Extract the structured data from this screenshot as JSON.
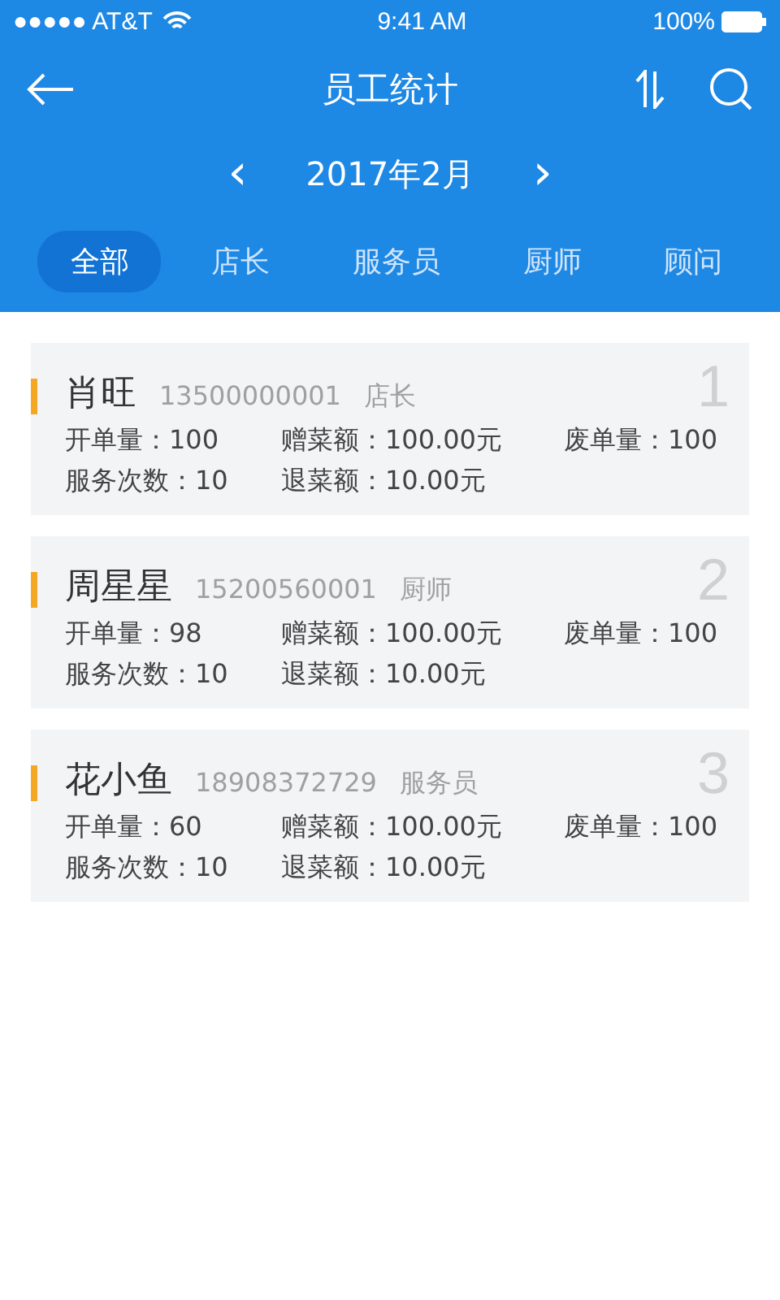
{
  "status_bar": {
    "carrier": "●●●●● AT&T",
    "time": "9:41 AM",
    "battery": "100%"
  },
  "header": {
    "title": "员工统计"
  },
  "month_nav": {
    "prev": "‹",
    "label": "2017年2月",
    "next": "›"
  },
  "tabs": [
    {
      "label": "全部",
      "selected": true
    },
    {
      "label": "店长",
      "selected": false
    },
    {
      "label": "服务员",
      "selected": false
    },
    {
      "label": "厨师",
      "selected": false
    },
    {
      "label": "顾问",
      "selected": false
    }
  ],
  "staff": [
    {
      "name": "肖旺",
      "phone": "13500000001",
      "role": "店长",
      "rank": "1",
      "stats": [
        "开单量：100",
        "赠菜额：100.00元",
        "废单量：100",
        "服务次数：10",
        "退菜额：10.00元"
      ]
    },
    {
      "name": "周星星",
      "phone": "15200560001",
      "role": "厨师",
      "rank": "2",
      "stats": [
        "开单量：98",
        "赠菜额：100.00元",
        "废单量：100",
        "服务次数：10",
        "退菜额：10.00元"
      ]
    },
    {
      "name": "花小鱼",
      "phone": "18908372729",
      "role": "服务员",
      "rank": "3",
      "stats": [
        "开单量：60",
        "赠菜额：100.00元",
        "废单量：100",
        "服务次数：10",
        "退菜额：10.00元"
      ]
    }
  ]
}
